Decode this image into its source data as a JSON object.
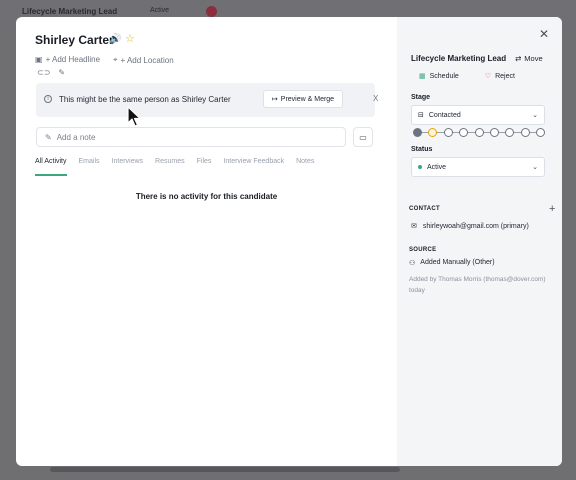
{
  "background": {
    "app_title": "Lifecycle Marketing Lead",
    "status": "Active"
  },
  "candidate": {
    "name": "Shirley Carter",
    "add_headline": "+ Add Headline",
    "add_location": "+ Add Location"
  },
  "banner": {
    "message": "This might be the same person as Shirley Carter",
    "preview_button": "Preview & Merge",
    "close": "X"
  },
  "note": {
    "placeholder": "Add a note"
  },
  "tabs": [
    "All Activity",
    "Emails",
    "Interviews",
    "Resumes",
    "Files",
    "Interview Feedback",
    "Notes"
  ],
  "active_tab": "All Activity",
  "empty_state": "There is no activity for this candidate",
  "sidebar": {
    "job_title": "Lifecycle Marketing Lead",
    "move_label": "Move",
    "schedule_label": "Schedule",
    "reject_label": "Reject",
    "stage_label": "Stage",
    "stage_value": "Contacted",
    "stage_steps": 9,
    "stage_current_index": 1,
    "status_label": "Status",
    "status_value": "Active",
    "contact_heading": "CONTACT",
    "contact_email": "shirleywoah@gmail.com (primary)",
    "source_heading": "SOURCE",
    "source_value": "Added Manually (Other)",
    "added_by": "Added by Thomas Morris (thomas@dover.com) today"
  },
  "colors": {
    "accent_green": "#3aa87a",
    "reject_red": "#d64545",
    "star_yellow": "#e8b400",
    "current_step": "#e8a400"
  }
}
